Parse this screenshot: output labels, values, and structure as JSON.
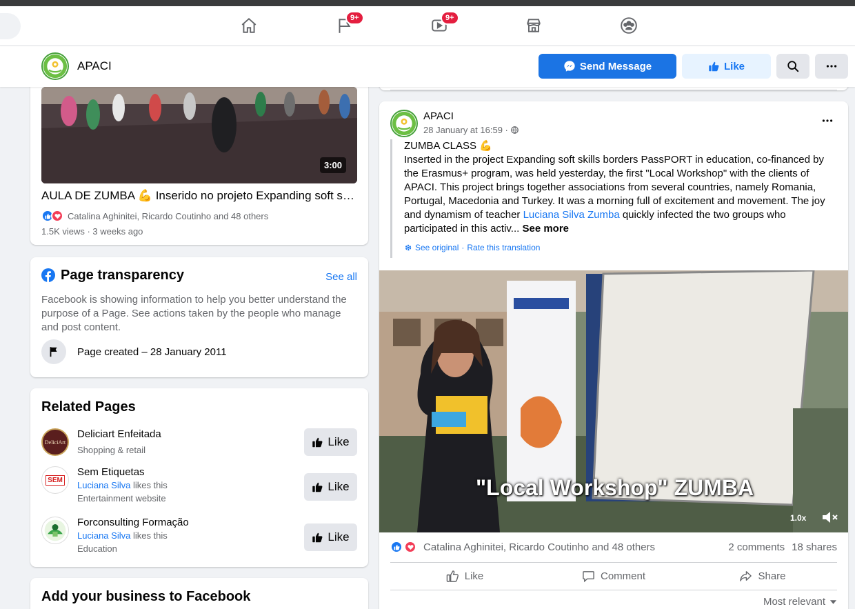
{
  "colors": {
    "accent": "#1877f2",
    "send_button": "#1b74e4",
    "badge": "#e41e3f",
    "like_react": "#1877f2",
    "love_react": "#f33e58",
    "page_logo_green": "#45a13a"
  },
  "topnav": {
    "items": [
      {
        "name": "home-icon",
        "badge": ""
      },
      {
        "name": "pages-flag-icon",
        "badge": "9+"
      },
      {
        "name": "watch-icon",
        "badge": "9+"
      },
      {
        "name": "marketplace-icon",
        "badge": ""
      },
      {
        "name": "groups-icon",
        "badge": ""
      }
    ]
  },
  "page_header": {
    "page_name": "APACI",
    "send_message_label": "Send Message",
    "like_label": "Like"
  },
  "video_card": {
    "duration": "3:00",
    "title": "AULA DE ZUMBA 💪 Inserido no projeto Expanding soft skills borders",
    "reactors": "Catalina Aghinitei, Ricardo Coutinho and 48 others",
    "meta": "1.5K views · 3 weeks ago"
  },
  "transparency": {
    "title": "Page transparency",
    "see_all": "See all",
    "description": "Facebook is showing information to help you better understand the purpose of a Page. See actions taken by the people who manage and post content.",
    "created": "Page created – 28 January 2011"
  },
  "related_pages": {
    "title": "Related Pages",
    "like_label": "Like",
    "items": [
      {
        "name": "Deliciart Enfeitada",
        "liker": "",
        "likes_text": "",
        "category": "Shopping & retail",
        "logo_text": "DeliciArt"
      },
      {
        "name": "Sem Etiquetas",
        "liker": "Luciana Silva",
        "likes_text": " likes this",
        "category": "Entertainment website",
        "logo_text": "SEM"
      },
      {
        "name": "Forconsulting Formação",
        "liker": "Luciana Silva",
        "likes_text": " likes this",
        "category": "Education",
        "logo_text": ""
      }
    ]
  },
  "business_card": {
    "title": "Add your business to Facebook"
  },
  "post": {
    "author": "APACI",
    "date": "28 January at 16:59 ·",
    "heading": "ZUMBA CLASS 💪",
    "body_before_link": "Inserted in the project Expanding soft skills borders PassPORT in education, co-financed by the Erasmus+ program, was held yesterday, the first \"Local Workshop\" with the clients of APACI. This project brings together associations from several countries, namely Romania, Portugal, Macedonia and Turkey. It was a morning full of excitement and movement. The joy and dynamism of teacher ",
    "body_link": "Luciana Silva Zumba",
    "body_after_link": " quickly infected the two groups who participated in this activ...",
    "see_more": "See more",
    "see_original": "See original",
    "separator": " · ",
    "rate_translation": "Rate this translation",
    "video_caption": "\"Local Workshop\" ZUMBA",
    "speed": "1.0x",
    "reactors": "Catalina Aghinitei, Ricardo Coutinho and 48 others",
    "comments": "2 comments",
    "shares": "18 shares",
    "like_label": "Like",
    "comment_label": "Comment",
    "share_label": "Share",
    "sort_label": "Most relevant"
  }
}
